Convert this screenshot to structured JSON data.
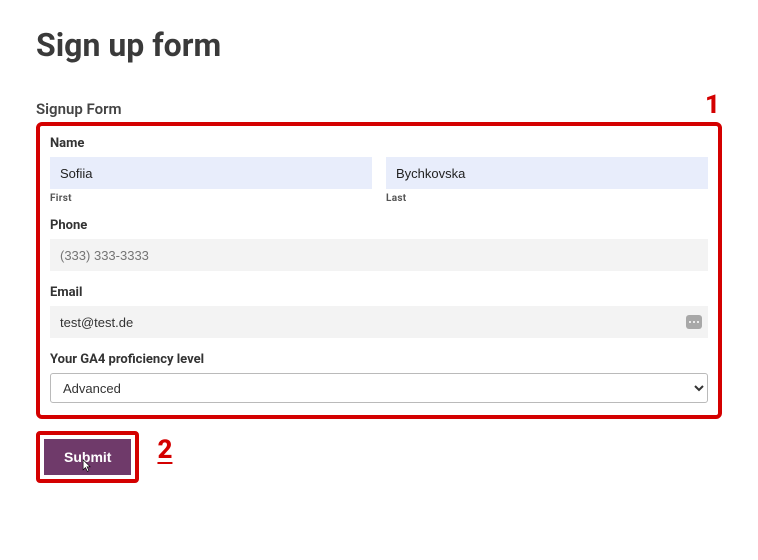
{
  "page_title": "Sign up form",
  "section_label": "Signup Form",
  "annotations": {
    "one": "1",
    "two": "2"
  },
  "fields": {
    "name": {
      "label": "Name",
      "first_value": "Sofiia",
      "last_value": "Bychkovska",
      "first_sublabel": "First",
      "last_sublabel": "Last"
    },
    "phone": {
      "label": "Phone",
      "placeholder": "(333) 333-3333",
      "value": ""
    },
    "email": {
      "label": "Email",
      "value": "test@test.de"
    },
    "level": {
      "label": "Your GA4 proficiency level",
      "selected": "Advanced"
    }
  },
  "submit_label": "Submit"
}
